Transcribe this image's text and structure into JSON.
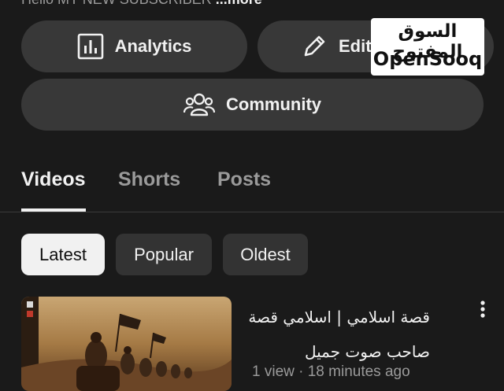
{
  "channel": {
    "description_prefix": "Hello MY NEW SUBSCRIBER",
    "description_more": "...more"
  },
  "actions": {
    "analytics_label": "Analytics",
    "edit_label": "Edit channel",
    "community_label": "Community"
  },
  "watermark": {
    "arabic": "السوق المفتوح",
    "english": "OpenSooq"
  },
  "tabs": [
    {
      "label": "Videos",
      "active": true
    },
    {
      "label": "Shorts",
      "active": false
    },
    {
      "label": "Posts",
      "active": false
    }
  ],
  "filters": [
    {
      "label": "Latest",
      "selected": true
    },
    {
      "label": "Popular",
      "selected": false
    },
    {
      "label": "Oldest",
      "selected": false
    }
  ],
  "video": {
    "title": "قصة اسلامي | اسلامي قصة صاحب صوت جميل",
    "meta": "1 view · 18 minutes ago"
  },
  "icons": [
    "analytics-icon",
    "pencil-icon",
    "community-icon",
    "more-vert-icon"
  ],
  "colors": {
    "background": "#1a1a1a",
    "button": "#383838",
    "chip_selected": "#f1f1f1",
    "chip_unselected": "#333333",
    "secondary_text": "#9a9a9a"
  }
}
